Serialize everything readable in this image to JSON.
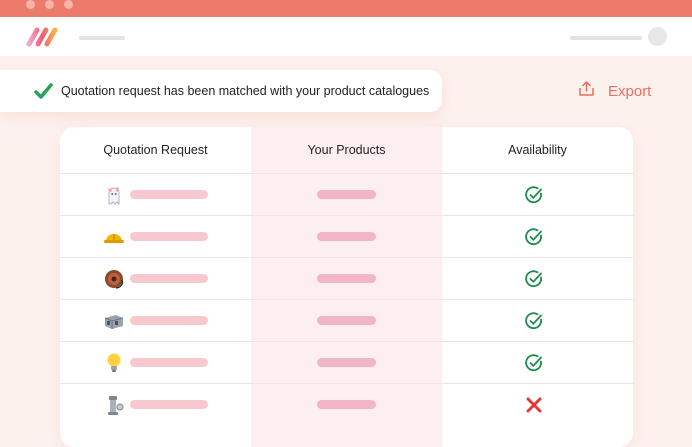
{
  "banner": {
    "message": "Quotation request has been matched with your product catalogues"
  },
  "actions": {
    "export_label": "Export"
  },
  "table": {
    "columns": [
      "Quotation Request",
      "Your Products",
      "Availability"
    ],
    "rows": [
      {
        "icon": "ghost-icon",
        "available": true
      },
      {
        "icon": "hard-hat-icon",
        "available": true
      },
      {
        "icon": "cable-reel-icon",
        "available": true
      },
      {
        "icon": "block-icon",
        "available": true
      },
      {
        "icon": "light-bulb-icon",
        "available": true
      },
      {
        "icon": "pipe-fitting-icon",
        "available": false
      }
    ]
  },
  "colors": {
    "accent": "#ec7b6b",
    "export": "#ec6e5e",
    "available": "#1f8a4c",
    "unavailable": "#e53935",
    "highlight_column": "#fdeef2"
  }
}
